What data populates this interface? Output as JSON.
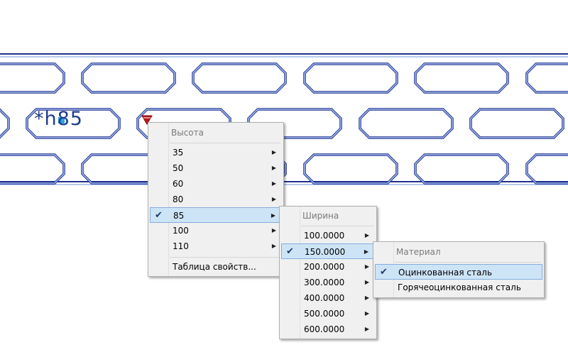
{
  "colors": {
    "outline_dark": "#1f2f8f",
    "outline_light": "#9fb8e8",
    "marker_red": "#c0141c",
    "grip_cyan": "#2aa7e0",
    "selected_bg": "#cde4f7",
    "selected_border": "#84acdd",
    "menu_bg": "#f0f0f0"
  },
  "drawing": {
    "dimension_label": "*h85",
    "grip_icon": "cyan-square-grip-icon",
    "insertion_marker_icon": "red-triangle-marker-icon"
  },
  "menu_height": {
    "header": "Высота",
    "items": [
      {
        "label": "35",
        "has_submenu": true,
        "checked": false
      },
      {
        "label": "50",
        "has_submenu": true,
        "checked": false
      },
      {
        "label": "60",
        "has_submenu": true,
        "checked": false
      },
      {
        "label": "80",
        "has_submenu": true,
        "checked": false
      },
      {
        "label": "85",
        "has_submenu": true,
        "checked": true
      },
      {
        "label": "100",
        "has_submenu": true,
        "checked": false
      },
      {
        "label": "110",
        "has_submenu": true,
        "checked": false
      }
    ],
    "footer_item": "Таблица свойств..."
  },
  "menu_width": {
    "header": "Ширина",
    "items": [
      {
        "label": "100.0000",
        "has_submenu": true,
        "checked": false
      },
      {
        "label": "150.0000",
        "has_submenu": true,
        "checked": true
      },
      {
        "label": "200.0000",
        "has_submenu": true,
        "checked": false
      },
      {
        "label": "300.0000",
        "has_submenu": true,
        "checked": false
      },
      {
        "label": "400.0000",
        "has_submenu": true,
        "checked": false
      },
      {
        "label": "500.0000",
        "has_submenu": true,
        "checked": false
      },
      {
        "label": "600.0000",
        "has_submenu": true,
        "checked": false
      }
    ]
  },
  "menu_material": {
    "header": "Материал",
    "items": [
      {
        "label": "Оцинкованная сталь",
        "checked": true
      },
      {
        "label": "Горячеоцинкованная сталь",
        "checked": false
      }
    ]
  },
  "icons": {
    "check": "checkmark-icon",
    "submenu_arrow": "chevron-right-icon"
  }
}
